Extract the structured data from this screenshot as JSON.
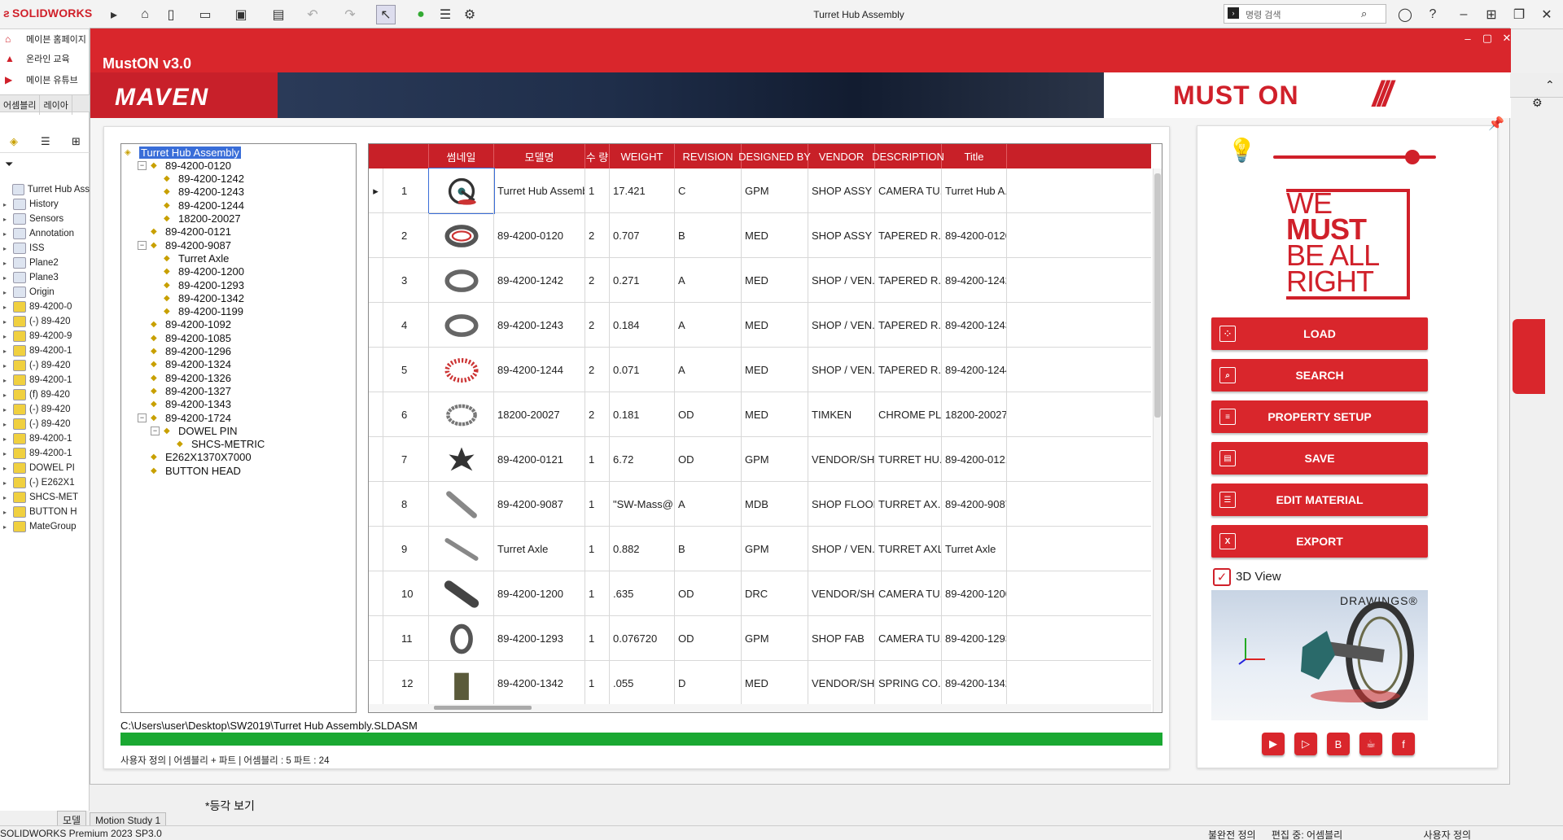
{
  "app": {
    "brand": "SOLIDWORKS",
    "window_title": "Turret Hub Assembly",
    "command_search_placeholder": "명령 검색"
  },
  "left_panel": {
    "links": [
      "메이븐 홈페이지",
      "온라인 교육",
      "메이븐 유튜브"
    ],
    "tabs": [
      "어셈블리",
      "레이아"
    ],
    "feature_tree": [
      "Turret Hub Ass",
      "History",
      "Sensors",
      "Annotation",
      "ISS",
      "Plane2",
      "Plane3",
      "Origin",
      "89-4200-0",
      "(-) 89-420",
      "89-4200-9",
      "89-4200-1",
      "(-) 89-420",
      "89-4200-1",
      "(f) 89-420",
      "(-) 89-420",
      "(-) 89-420",
      "89-4200-1",
      "89-4200-1",
      "DOWEL PI",
      "(-) E262X1",
      "SHCS-MET",
      "BUTTON H",
      "MateGroup"
    ]
  },
  "muston": {
    "title": "MustON v3.0",
    "maven_logo": "MAVEN",
    "muston_logo": "MUST ON",
    "tree": [
      {
        "label": "Turret Hub Assembly",
        "level": 0,
        "toggle": "",
        "selected": true
      },
      {
        "label": "89-4200-0120",
        "level": 1,
        "toggle": "−"
      },
      {
        "label": "89-4200-1242",
        "level": 2,
        "toggle": ""
      },
      {
        "label": "89-4200-1243",
        "level": 2,
        "toggle": ""
      },
      {
        "label": "89-4200-1244",
        "level": 2,
        "toggle": ""
      },
      {
        "label": "18200-20027",
        "level": 2,
        "toggle": ""
      },
      {
        "label": "89-4200-0121",
        "level": 1,
        "toggle": ""
      },
      {
        "label": "89-4200-9087",
        "level": 1,
        "toggle": "−"
      },
      {
        "label": "Turret Axle",
        "level": 2,
        "toggle": ""
      },
      {
        "label": "89-4200-1200",
        "level": 2,
        "toggle": ""
      },
      {
        "label": "89-4200-1293",
        "level": 2,
        "toggle": ""
      },
      {
        "label": "89-4200-1342",
        "level": 2,
        "toggle": ""
      },
      {
        "label": "89-4200-1199",
        "level": 2,
        "toggle": ""
      },
      {
        "label": "89-4200-1092",
        "level": 1,
        "toggle": ""
      },
      {
        "label": "89-4200-1085",
        "level": 1,
        "toggle": ""
      },
      {
        "label": "89-4200-1296",
        "level": 1,
        "toggle": ""
      },
      {
        "label": "89-4200-1324",
        "level": 1,
        "toggle": ""
      },
      {
        "label": "89-4200-1326",
        "level": 1,
        "toggle": ""
      },
      {
        "label": "89-4200-1327",
        "level": 1,
        "toggle": ""
      },
      {
        "label": "89-4200-1343",
        "level": 1,
        "toggle": ""
      },
      {
        "label": "89-4200-1724",
        "level": 1,
        "toggle": "−"
      },
      {
        "label": "DOWEL PIN",
        "level": 2,
        "toggle": "−"
      },
      {
        "label": "SHCS-METRIC",
        "level": 3,
        "toggle": ""
      },
      {
        "label": "E262X1370X7000",
        "level": 1,
        "toggle": ""
      },
      {
        "label": "BUTTON HEAD",
        "level": 1,
        "toggle": ""
      }
    ],
    "grid": {
      "headers": [
        "",
        "",
        "썸네일",
        "모델명",
        "수 량",
        "WEIGHT",
        "REVISION",
        "DESIGNED BY",
        "VENDOR",
        "DESCRIPTION",
        "Title"
      ],
      "rows": [
        [
          "1",
          "wheel",
          "Turret Hub Assembly",
          "1",
          "17.421",
          "C",
          "GPM",
          "SHOP ASSY",
          "CAMERA TU...",
          "Turret Hub A..."
        ],
        [
          "2",
          "ring-red",
          "89-4200-0120",
          "2",
          "0.707",
          "B",
          "MED",
          "SHOP ASSY",
          "TAPERED R...",
          "89-4200-0120"
        ],
        [
          "3",
          "ring-grey",
          "89-4200-1242",
          "2",
          "0.271",
          "A",
          "MED",
          "SHOP / VEN...",
          "TAPERED R...",
          "89-4200-1242"
        ],
        [
          "4",
          "ring-grey",
          "89-4200-1243",
          "2",
          "0.184",
          "A",
          "MED",
          "SHOP / VEN...",
          "TAPERED R...",
          "89-4200-1243"
        ],
        [
          "5",
          "cage-red",
          "89-4200-1244",
          "2",
          "0.071",
          "A",
          "MED",
          "SHOP / VEN...",
          "TAPERED R...",
          "89-4200-1244"
        ],
        [
          "6",
          "chain",
          "18200-20027",
          "2",
          "0.181",
          "OD",
          "MED",
          "TIMKEN",
          "CHROME PL...",
          "18200-20027"
        ],
        [
          "7",
          "star",
          "89-4200-0121",
          "1",
          "6.72",
          "OD",
          "GPM",
          "VENDOR/SH...",
          "TURRET HU...",
          "89-4200-0121"
        ],
        [
          "8",
          "shaft",
          "89-4200-9087",
          "1",
          "\"SW-Mass@...",
          "A",
          "MDB",
          "SHOP FLOOR",
          "TURRET AX...",
          "89-4200-9087"
        ],
        [
          "9",
          "shaft-long",
          "Turret Axle",
          "1",
          "0.882",
          "B",
          "GPM",
          "SHOP / VEN...",
          "TURRET AXLE",
          "Turret Axle"
        ],
        [
          "10",
          "tube",
          "89-4200-1200",
          "1",
          ".635",
          "OD",
          "DRC",
          "VENDOR/SH...",
          "CAMERA TU...",
          "89-4200-1200"
        ],
        [
          "11",
          "clamp",
          "89-4200-1293",
          "1",
          "0.076720",
          "OD",
          "GPM",
          "SHOP FAB",
          "CAMERA TU...",
          "89-4200-1293"
        ],
        [
          "12",
          "block",
          "89-4200-1342",
          "1",
          ".055",
          "D",
          "MED",
          "VENDOR/SH...",
          "SPRING CO...",
          "89-4200-1342"
        ]
      ]
    },
    "path": "C:\\Users\\user\\Desktop\\SW2019\\Turret Hub Assembly.SLDASM",
    "progress": 1.0,
    "status": "사용자 정의    |    어셈블리 + 파트    |    어셈블리 : 5    파트 : 24",
    "motto": [
      "WE",
      "MUST",
      "BE ALL",
      "RIGHT"
    ],
    "buttons": [
      "LOAD",
      "SEARCH",
      "PROPERTY SETUP",
      "SAVE",
      "EDIT MATERIAL",
      "EXPORT"
    ],
    "view3d_label": "3D View",
    "edrawings_label": "DRAWINGS®",
    "colors": {
      "accent": "#d9262c",
      "progress": "#1aa832"
    }
  },
  "bottom": {
    "tabs": [
      "모델",
      "Motion Study 1"
    ],
    "view_label": "*등각 보기",
    "status_left": "SOLIDWORKS Premium 2023 SP3.0",
    "status_right": [
      "불완전 정의",
      "편집 중: 어셈블리",
      "사용자 정의"
    ]
  }
}
